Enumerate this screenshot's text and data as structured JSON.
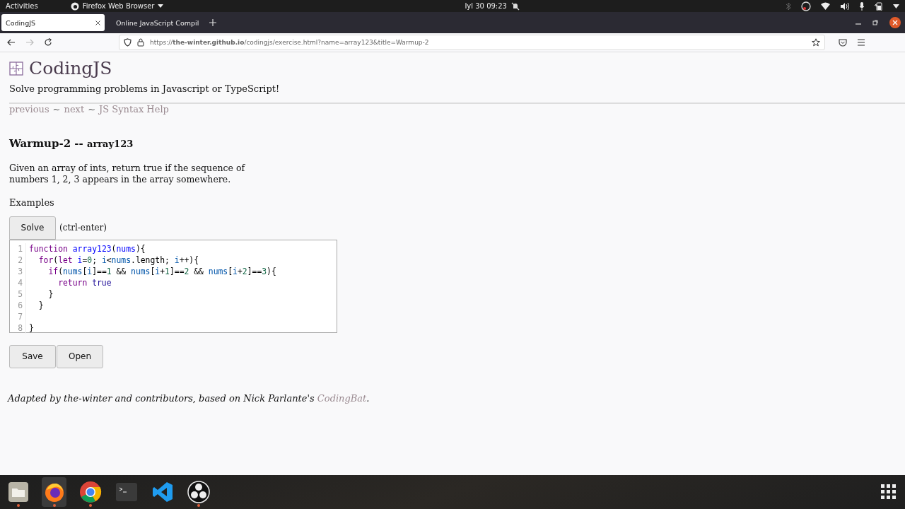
{
  "topbar": {
    "activities": "Activities",
    "app_menu": "Firefox Web Browser",
    "clock": "Iyl 30  09:23"
  },
  "tabs": [
    {
      "title": "CodingJS",
      "selected": true
    },
    {
      "title": "Online JavaScript Compil",
      "selected": false
    }
  ],
  "address_bar": {
    "url": "https://**the-winter.github.io**/codingjs/exercise.html?name=array123&title=Warmup-2"
  },
  "page": {
    "logo": "CodingJS",
    "tagline": "Solve programming problems in Javascript or TypeScript!",
    "nav": [
      {
        "label": "previous"
      },
      {
        "label": "next"
      },
      {
        "label": "JS Syntax Help"
      }
    ],
    "nav_separator": "~",
    "heading": "Warmup-2 --",
    "heading_name": "array123",
    "description": "Given an array of ints, return true if the sequence of numbers 1, 2, 3 appears in the array somewhere.",
    "examples": "Examples",
    "solve_button": "Solve",
    "shortcut": "(ctrl-enter)",
    "code": [
      {
        "number": "1",
        "tokens": [
          {
            "kind": "keyword",
            "text": "function"
          },
          {
            "kind": "def",
            "text": " array123"
          },
          {
            "kind": "plain",
            "text": "("
          },
          {
            "kind": "def",
            "text": "nums"
          },
          {
            "kind": "plain",
            "text": "){"
          }
        ]
      },
      {
        "number": "2",
        "tokens": [
          {
            "kind": "keyword",
            "text": "  for"
          },
          {
            "kind": "plain",
            "text": "("
          },
          {
            "kind": "keyword",
            "text": "let"
          },
          {
            "kind": "def",
            "text": " i"
          },
          {
            "kind": "plain",
            "text": "="
          },
          {
            "kind": "number",
            "text": "0"
          },
          {
            "kind": "plain",
            "text": "; "
          },
          {
            "kind": "variable",
            "text": "i"
          },
          {
            "kind": "plain",
            "text": "<"
          },
          {
            "kind": "variable",
            "text": "nums"
          },
          {
            "kind": "plain",
            "text": ".length; "
          },
          {
            "kind": "variable",
            "text": "i"
          },
          {
            "kind": "plain",
            "text": "++){"
          }
        ]
      },
      {
        "number": "3",
        "tokens": [
          {
            "kind": "keyword",
            "text": "    if"
          },
          {
            "kind": "plain",
            "text": "("
          },
          {
            "kind": "variable",
            "text": "nums"
          },
          {
            "kind": "plain",
            "text": "["
          },
          {
            "kind": "variable",
            "text": "i"
          },
          {
            "kind": "plain",
            "text": "]=="
          },
          {
            "kind": "number",
            "text": "1"
          },
          {
            "kind": "plain",
            "text": " && "
          },
          {
            "kind": "variable",
            "text": "nums"
          },
          {
            "kind": "plain",
            "text": "["
          },
          {
            "kind": "variable",
            "text": "i"
          },
          {
            "kind": "plain",
            "text": "+"
          },
          {
            "kind": "number",
            "text": "1"
          },
          {
            "kind": "plain",
            "text": "]=="
          },
          {
            "kind": "number",
            "text": "2"
          },
          {
            "kind": "plain",
            "text": " && "
          },
          {
            "kind": "variable",
            "text": "nums"
          },
          {
            "kind": "plain",
            "text": "["
          },
          {
            "kind": "variable",
            "text": "i"
          },
          {
            "kind": "plain",
            "text": "+"
          },
          {
            "kind": "number",
            "text": "2"
          },
          {
            "kind": "plain",
            "text": "]=="
          },
          {
            "kind": "number",
            "text": "3"
          },
          {
            "kind": "plain",
            "text": "){"
          }
        ]
      },
      {
        "number": "4",
        "tokens": [
          {
            "kind": "keyword",
            "text": "      return"
          },
          {
            "kind": "atom",
            "text": " true"
          }
        ]
      },
      {
        "number": "5",
        "tokens": [
          {
            "kind": "plain",
            "text": "    }"
          }
        ]
      },
      {
        "number": "6",
        "tokens": [
          {
            "kind": "plain",
            "text": "  }"
          }
        ]
      },
      {
        "number": "7"
      },
      {
        "number": "8",
        "tokens": [
          {
            "kind": "plain",
            "text": "}"
          }
        ]
      }
    ],
    "save_button": "Save",
    "open_button": "Open",
    "footer": {
      "before": "Adapted by the-winter and contributors, based on Nick Parlante's ",
      "link": "CodingBat",
      "after": "."
    }
  },
  "dock": [
    {
      "kind": "files",
      "running": true,
      "selected": false
    },
    {
      "kind": "firefox",
      "running": true,
      "selected": true
    },
    {
      "kind": "chrome",
      "running": true,
      "selected": false
    },
    {
      "kind": "terminal",
      "running": false,
      "selected": false
    },
    {
      "kind": "vscode",
      "running": false,
      "selected": false
    },
    {
      "kind": "obs",
      "running": true,
      "selected": false
    }
  ]
}
